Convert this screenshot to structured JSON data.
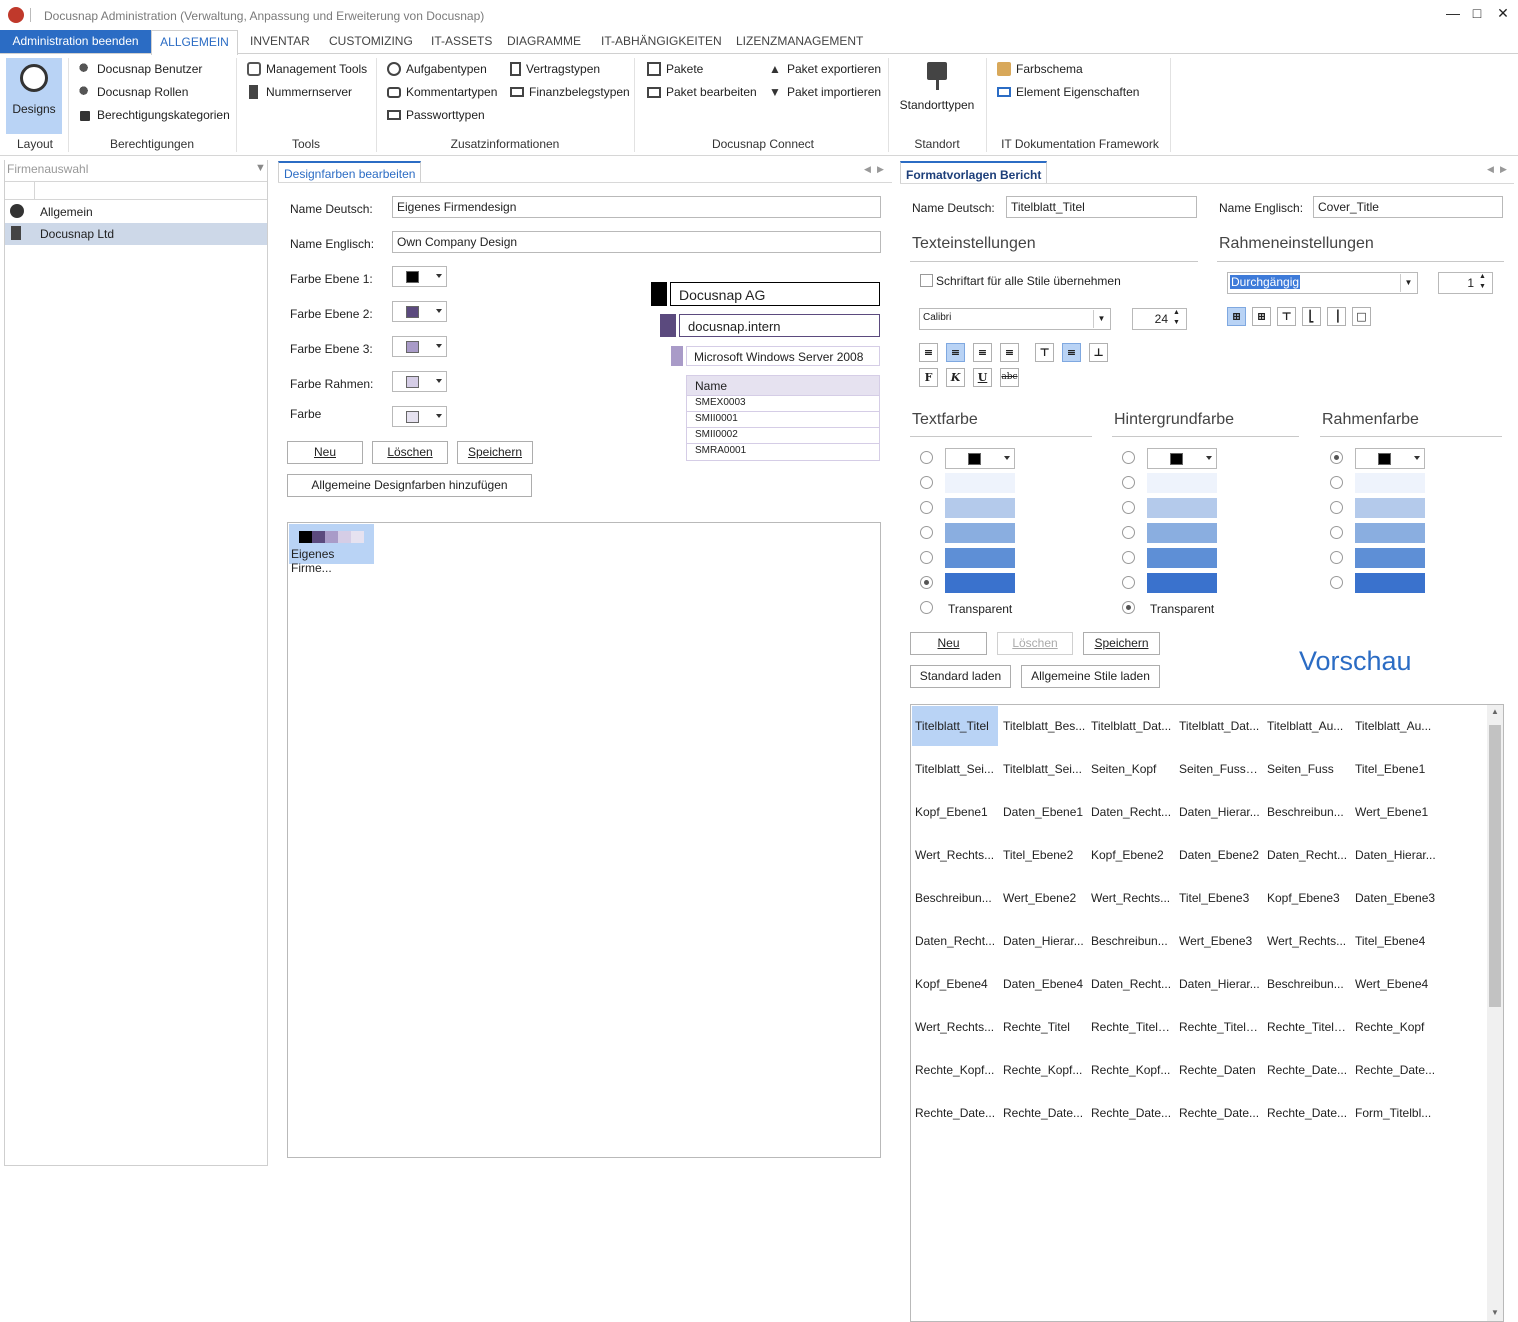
{
  "window": {
    "title": "Docusnap Administration (Verwaltung, Anpassung und Erweiterung von Docusnap)"
  },
  "tabs": {
    "admin_end": "Administration beenden",
    "items": [
      "ALLGEMEIN",
      "INVENTAR",
      "CUSTOMIZING",
      "IT-ASSETS",
      "DIAGRAMME",
      "IT-ABHÄNGIGKEITEN",
      "LIZENZMANAGEMENT"
    ]
  },
  "ribbon": {
    "layout": {
      "button": "Designs",
      "title": "Layout"
    },
    "berechtigungen": {
      "items": [
        "Docusnap Benutzer",
        "Docusnap Rollen",
        "Berechtigungskategorien"
      ],
      "title": "Berechtigungen"
    },
    "tools": {
      "items": [
        "Management Tools",
        "Nummernserver"
      ],
      "title": "Tools"
    },
    "zusatz": {
      "col1": [
        "Aufgabentypen",
        "Kommentartypen",
        "Passworttypen"
      ],
      "col2": [
        "Vertragstypen",
        "Finanzbelegstypen"
      ],
      "title": "Zusatzinformationen"
    },
    "connect": {
      "col1": [
        "Pakete",
        "Paket bearbeiten"
      ],
      "col2": [
        "Paket exportieren",
        "Paket importieren"
      ],
      "title": "Docusnap Connect"
    },
    "standort": {
      "button": "Standorttypen",
      "title": "Standort"
    },
    "framework": {
      "items": [
        "Farbschema",
        "Element Eigenschaften"
      ],
      "title": "IT Dokumentation Framework"
    }
  },
  "firmenauswahl": {
    "title": "Firmenauswahl",
    "items": [
      "Allgemein",
      "Docusnap Ltd"
    ]
  },
  "designfarben": {
    "tab": "Designfarben bearbeiten",
    "name_de_label": "Name Deutsch:",
    "name_de_value": "Eigenes Firmendesign",
    "name_en_label": "Name Englisch:",
    "name_en_value": "Own Company Design",
    "farbe1": "Farbe Ebene 1:",
    "farbe2": "Farbe Ebene 2:",
    "farbe3": "Farbe Ebene 3:",
    "farbe_rahmen": "Farbe Rahmen:",
    "farbe": "Farbe",
    "btn_neu": "Neu",
    "btn_loeschen": "Löschen",
    "btn_speichern": "Speichern",
    "btn_allgemein": "Allgemeine Designfarben hinzufügen",
    "preview": {
      "level1": "Docusnap AG",
      "level2": "docusnap.intern",
      "level3": "Microsoft Windows Server 2008",
      "table_header": "Name",
      "rows": [
        "SMEX0003",
        "SMII0001",
        "SMII0002",
        "SMRA0001"
      ]
    },
    "design_item": "Eigenes Firme..."
  },
  "colors": {
    "level1": "#000000",
    "level2": "#5b4a7e",
    "level3": "#a99bc8",
    "rahmen": "#d5cde6",
    "farbe": "#e6e2f0",
    "accent": "#2b6cc4"
  },
  "formatvorlagen": {
    "tab": "Formatvorlagen Bericht",
    "name_de_label": "Name Deutsch:",
    "name_de_value": "Titelblatt_Titel",
    "name_en_label": "Name Englisch:",
    "name_en_value": "Cover_Title",
    "texteinstellungen": "Texteinstellungen",
    "rahmeneinstellungen": "Rahmeneinstellungen",
    "schriftart_check": "Schriftart für alle Stile übernehmen",
    "font": "Calibri",
    "font_size": "24",
    "border_style": "Durchgängig",
    "border_width": "1",
    "textfarbe": "Textfarbe",
    "hintergrundfarbe": "Hintergrundfarbe",
    "rahmenfarbe": "Rahmenfarbe",
    "transparent": "Transparent",
    "btn_neu": "Neu",
    "btn_loeschen": "Löschen",
    "btn_speichern": "Speichern",
    "btn_standard": "Standard laden",
    "btn_allgemein": "Allgemeine Stile laden",
    "vorschau": "Vorschau",
    "styles": [
      [
        "Titelblatt_Titel",
        "Titelblatt_Bes...",
        "Titelblatt_Dat...",
        "Titelblatt_Dat...",
        "Titelblatt_Au...",
        "Titelblatt_Au..."
      ],
      [
        "Titelblatt_Sei...",
        "Titelblatt_Sei...",
        "Seiten_Kopf",
        "Seiten_Fuss_...",
        "Seiten_Fuss",
        "Titel_Ebene1"
      ],
      [
        "Kopf_Ebene1",
        "Daten_Ebene1",
        "Daten_Recht...",
        "Daten_Hierar...",
        "Beschreibun...",
        "Wert_Ebene1"
      ],
      [
        "Wert_Rechts...",
        "Titel_Ebene2",
        "Kopf_Ebene2",
        "Daten_Ebene2",
        "Daten_Recht...",
        "Daten_Hierar..."
      ],
      [
        "Beschreibun...",
        "Wert_Ebene2",
        "Wert_Rechts...",
        "Titel_Ebene3",
        "Kopf_Ebene3",
        "Daten_Ebene3"
      ],
      [
        "Daten_Recht...",
        "Daten_Hierar...",
        "Beschreibun...",
        "Wert_Ebene3",
        "Wert_Rechts...",
        "Titel_Ebene4"
      ],
      [
        "Kopf_Ebene4",
        "Daten_Ebene4",
        "Daten_Recht...",
        "Daten_Hierar...",
        "Beschreibun...",
        "Wert_Ebene4"
      ],
      [
        "Wert_Rechts...",
        "Rechte_Titel",
        "Rechte_Titel_...",
        "Rechte_Titel_...",
        "Rechte_Titel_...",
        "Rechte_Kopf"
      ],
      [
        "Rechte_Kopf...",
        "Rechte_Kopf...",
        "Rechte_Kopf...",
        "Rechte_Daten",
        "Rechte_Date...",
        "Rechte_Date..."
      ],
      [
        "Rechte_Date...",
        "Rechte_Date...",
        "Rechte_Date...",
        "Rechte_Date...",
        "Rechte_Date...",
        "Form_Titelbl..."
      ]
    ]
  }
}
